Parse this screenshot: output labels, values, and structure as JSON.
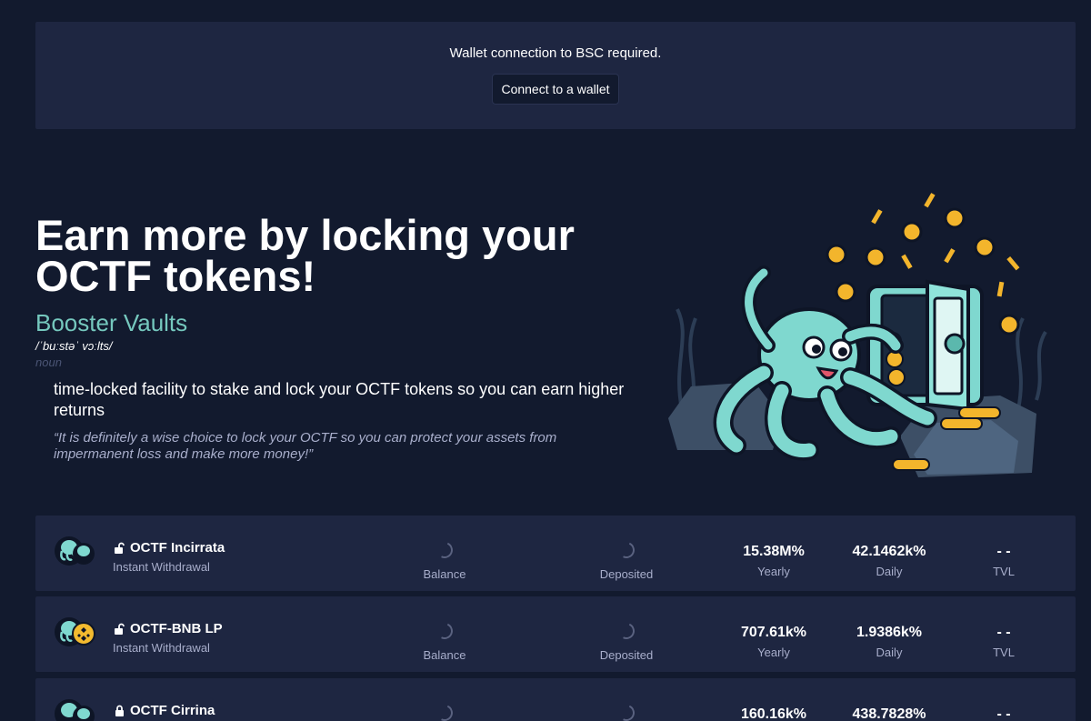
{
  "banner": {
    "message": "Wallet connection to BSC required.",
    "connect_label": "Connect to a wallet"
  },
  "hero": {
    "title_line1": "Earn more by locking your",
    "title_line2": "OCTF tokens!",
    "subtitle": "Booster Vaults",
    "phonetic": "/ˈbuːstəˈ vɔːlts/",
    "part_of_speech": "noun",
    "definition": "time-locked facility to stake and lock your OCTF tokens so you can earn higher returns",
    "quote": "“It is definitely a wise choice to lock your OCTF so you can protect your assets from impermanent loss and make more money!”"
  },
  "colors": {
    "background": "#121a2e",
    "card": "#1e2641",
    "accent": "#75c8be",
    "muted": "#a8aecb"
  },
  "vaults": [
    {
      "name": "OCTF Incirrata",
      "subtitle": "Instant Withdrawal",
      "lock_icon": "unlock-icon",
      "balance_label": "Balance",
      "deposited_label": "Deposited",
      "yearly": "15.38M%",
      "yearly_label": "Yearly",
      "daily": "42.1462k%",
      "daily_label": "Daily",
      "tvl": "- -",
      "tvl_label": "TVL"
    },
    {
      "name": "OCTF-BNB LP",
      "subtitle": "Instant Withdrawal",
      "lock_icon": "unlock-icon",
      "balance_label": "Balance",
      "deposited_label": "Deposited",
      "yearly": "707.61k%",
      "yearly_label": "Yearly",
      "daily": "1.9386k%",
      "daily_label": "Daily",
      "tvl": "- -",
      "tvl_label": "TVL"
    },
    {
      "name": "OCTF Cirrina",
      "subtitle": "",
      "lock_icon": "lock-icon",
      "balance_label": "",
      "deposited_label": "",
      "yearly": "160.16k%",
      "yearly_label": "",
      "daily": "438.7828%",
      "daily_label": "",
      "tvl": "- -",
      "tvl_label": ""
    }
  ]
}
